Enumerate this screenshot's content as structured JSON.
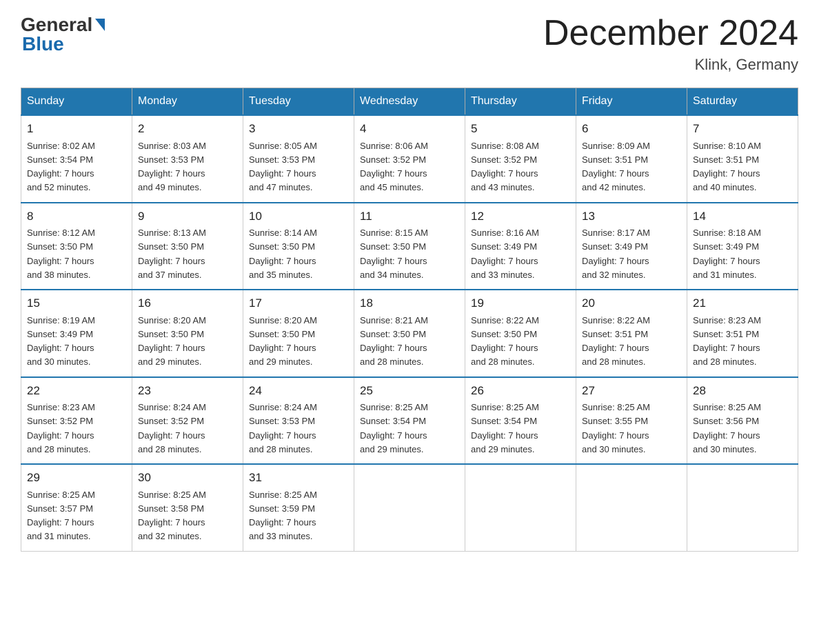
{
  "logo": {
    "general": "General",
    "blue": "Blue"
  },
  "title": "December 2024",
  "location": "Klink, Germany",
  "days_of_week": [
    "Sunday",
    "Monday",
    "Tuesday",
    "Wednesday",
    "Thursday",
    "Friday",
    "Saturday"
  ],
  "weeks": [
    [
      {
        "day": "1",
        "sunrise": "8:02 AM",
        "sunset": "3:54 PM",
        "daylight": "7 hours and 52 minutes."
      },
      {
        "day": "2",
        "sunrise": "8:03 AM",
        "sunset": "3:53 PM",
        "daylight": "7 hours and 49 minutes."
      },
      {
        "day": "3",
        "sunrise": "8:05 AM",
        "sunset": "3:53 PM",
        "daylight": "7 hours and 47 minutes."
      },
      {
        "day": "4",
        "sunrise": "8:06 AM",
        "sunset": "3:52 PM",
        "daylight": "7 hours and 45 minutes."
      },
      {
        "day": "5",
        "sunrise": "8:08 AM",
        "sunset": "3:52 PM",
        "daylight": "7 hours and 43 minutes."
      },
      {
        "day": "6",
        "sunrise": "8:09 AM",
        "sunset": "3:51 PM",
        "daylight": "7 hours and 42 minutes."
      },
      {
        "day": "7",
        "sunrise": "8:10 AM",
        "sunset": "3:51 PM",
        "daylight": "7 hours and 40 minutes."
      }
    ],
    [
      {
        "day": "8",
        "sunrise": "8:12 AM",
        "sunset": "3:50 PM",
        "daylight": "7 hours and 38 minutes."
      },
      {
        "day": "9",
        "sunrise": "8:13 AM",
        "sunset": "3:50 PM",
        "daylight": "7 hours and 37 minutes."
      },
      {
        "day": "10",
        "sunrise": "8:14 AM",
        "sunset": "3:50 PM",
        "daylight": "7 hours and 35 minutes."
      },
      {
        "day": "11",
        "sunrise": "8:15 AM",
        "sunset": "3:50 PM",
        "daylight": "7 hours and 34 minutes."
      },
      {
        "day": "12",
        "sunrise": "8:16 AM",
        "sunset": "3:49 PM",
        "daylight": "7 hours and 33 minutes."
      },
      {
        "day": "13",
        "sunrise": "8:17 AM",
        "sunset": "3:49 PM",
        "daylight": "7 hours and 32 minutes."
      },
      {
        "day": "14",
        "sunrise": "8:18 AM",
        "sunset": "3:49 PM",
        "daylight": "7 hours and 31 minutes."
      }
    ],
    [
      {
        "day": "15",
        "sunrise": "8:19 AM",
        "sunset": "3:49 PM",
        "daylight": "7 hours and 30 minutes."
      },
      {
        "day": "16",
        "sunrise": "8:20 AM",
        "sunset": "3:50 PM",
        "daylight": "7 hours and 29 minutes."
      },
      {
        "day": "17",
        "sunrise": "8:20 AM",
        "sunset": "3:50 PM",
        "daylight": "7 hours and 29 minutes."
      },
      {
        "day": "18",
        "sunrise": "8:21 AM",
        "sunset": "3:50 PM",
        "daylight": "7 hours and 28 minutes."
      },
      {
        "day": "19",
        "sunrise": "8:22 AM",
        "sunset": "3:50 PM",
        "daylight": "7 hours and 28 minutes."
      },
      {
        "day": "20",
        "sunrise": "8:22 AM",
        "sunset": "3:51 PM",
        "daylight": "7 hours and 28 minutes."
      },
      {
        "day": "21",
        "sunrise": "8:23 AM",
        "sunset": "3:51 PM",
        "daylight": "7 hours and 28 minutes."
      }
    ],
    [
      {
        "day": "22",
        "sunrise": "8:23 AM",
        "sunset": "3:52 PM",
        "daylight": "7 hours and 28 minutes."
      },
      {
        "day": "23",
        "sunrise": "8:24 AM",
        "sunset": "3:52 PM",
        "daylight": "7 hours and 28 minutes."
      },
      {
        "day": "24",
        "sunrise": "8:24 AM",
        "sunset": "3:53 PM",
        "daylight": "7 hours and 28 minutes."
      },
      {
        "day": "25",
        "sunrise": "8:25 AM",
        "sunset": "3:54 PM",
        "daylight": "7 hours and 29 minutes."
      },
      {
        "day": "26",
        "sunrise": "8:25 AM",
        "sunset": "3:54 PM",
        "daylight": "7 hours and 29 minutes."
      },
      {
        "day": "27",
        "sunrise": "8:25 AM",
        "sunset": "3:55 PM",
        "daylight": "7 hours and 30 minutes."
      },
      {
        "day": "28",
        "sunrise": "8:25 AM",
        "sunset": "3:56 PM",
        "daylight": "7 hours and 30 minutes."
      }
    ],
    [
      {
        "day": "29",
        "sunrise": "8:25 AM",
        "sunset": "3:57 PM",
        "daylight": "7 hours and 31 minutes."
      },
      {
        "day": "30",
        "sunrise": "8:25 AM",
        "sunset": "3:58 PM",
        "daylight": "7 hours and 32 minutes."
      },
      {
        "day": "31",
        "sunrise": "8:25 AM",
        "sunset": "3:59 PM",
        "daylight": "7 hours and 33 minutes."
      },
      null,
      null,
      null,
      null
    ]
  ],
  "labels": {
    "sunrise": "Sunrise:",
    "sunset": "Sunset:",
    "daylight": "Daylight:"
  }
}
